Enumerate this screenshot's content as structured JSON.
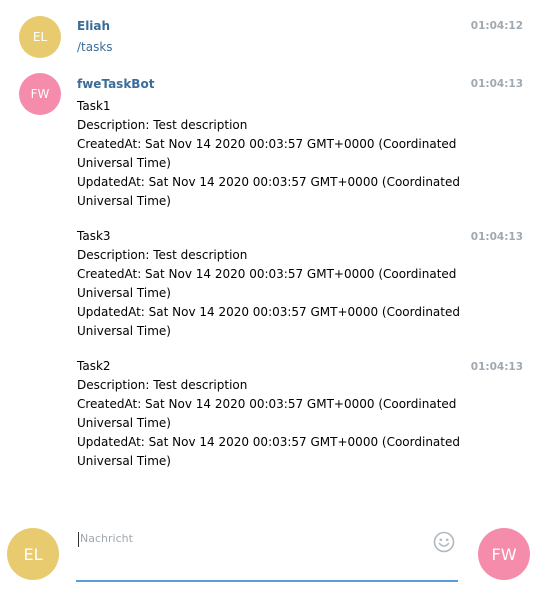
{
  "messages": [
    {
      "sender": "Eliah",
      "initials": "EL",
      "time": "01:04:12",
      "text": "/tasks"
    },
    {
      "sender": "fweTaskBot",
      "initials": "FW",
      "groups": [
        {
          "time": "01:04:13",
          "text": "Task1\nDescription: Test description\nCreatedAt: Sat Nov 14 2020 00:03:57 GMT+0000 (Coordinated Universal Time)\nUpdatedAt: Sat Nov 14 2020 00:03:57 GMT+0000 (Coordinated Universal Time)"
        },
        {
          "time": "01:04:13",
          "text": "Task3\nDescription: Test description\nCreatedAt: Sat Nov 14 2020 00:03:57 GMT+0000 (Coordinated Universal Time)\nUpdatedAt: Sat Nov 14 2020 00:03:57 GMT+0000 (Coordinated Universal Time)"
        },
        {
          "time": "01:04:13",
          "text": "Task2\nDescription: Test description\nCreatedAt: Sat Nov 14 2020 00:03:57 GMT+0000 (Coordinated Universal Time)\nUpdatedAt: Sat Nov 14 2020 00:03:57 GMT+0000 (Coordinated Universal Time)"
        }
      ]
    }
  ],
  "composer": {
    "user_initials": "EL",
    "bot_initials": "FW",
    "placeholder": "Nachricht",
    "emoji_icon": "smiley-icon"
  },
  "colors": {
    "user_avatar": "#e8ca6f",
    "bot_avatar": "#f58cab",
    "name": "#3a6d99",
    "timestamp": "#a0a8b0",
    "input_underline": "#5a9ed9"
  }
}
